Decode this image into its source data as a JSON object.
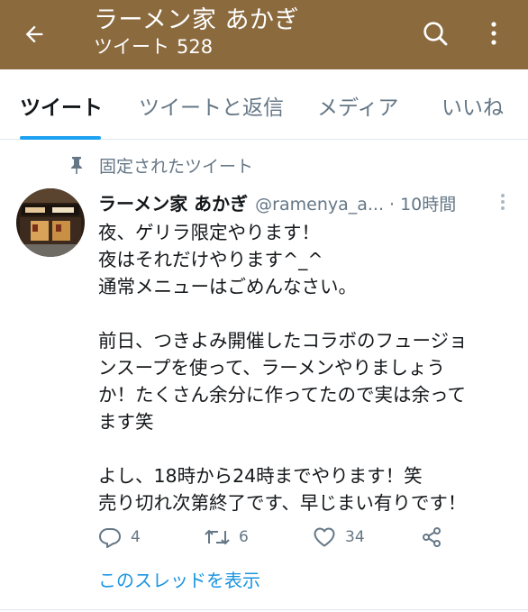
{
  "header": {
    "title": "ラーメン家 あかぎ",
    "subtitle_label": "ツイート",
    "tweet_count": "528",
    "bg_color": "#8b6a3e",
    "icons": {
      "back": "arrow-left-icon",
      "search": "search-icon",
      "more": "more-vertical-icon"
    }
  },
  "tabs": [
    {
      "label": "ツイート",
      "active": true
    },
    {
      "label": "ツイートと返信",
      "active": false
    },
    {
      "label": "メディア",
      "active": false
    },
    {
      "label": "いいね",
      "active": false
    }
  ],
  "accent_color": "#1da1f2",
  "pinned": {
    "label": "固定されたツイート",
    "icon": "pin-icon"
  },
  "tweet": {
    "author": "ラーメン家 あかぎ",
    "handle": "@ramenya_a...",
    "separator": "·",
    "time": "10時間",
    "avatar": {
      "icon": "shop-front-avatar"
    },
    "body": {
      "l1": "夜、ゲリラ限定やります！",
      "l2": "夜はそれだけやります^_^",
      "l3": "通常メニューはごめんなさい。",
      "l4": "前日、つきよみ開催したコラボのフュージョ",
      "l5": "ンスープを使って、ラーメンやりましょう",
      "l6": "か！たくさん余分に作ってたので実は余って",
      "l7": "ます笑",
      "l8": "よし、18時から24時までやります！笑",
      "l9": "売り切れ次第終了です、早じまい有りです！"
    },
    "actions": {
      "reply": {
        "icon": "reply-icon",
        "count": "4"
      },
      "retweet": {
        "icon": "retweet-icon",
        "count": "6"
      },
      "like": {
        "icon": "heart-icon",
        "count": "34"
      },
      "share": {
        "icon": "share-icon"
      }
    },
    "thread_link": "このスレッドを表示"
  }
}
